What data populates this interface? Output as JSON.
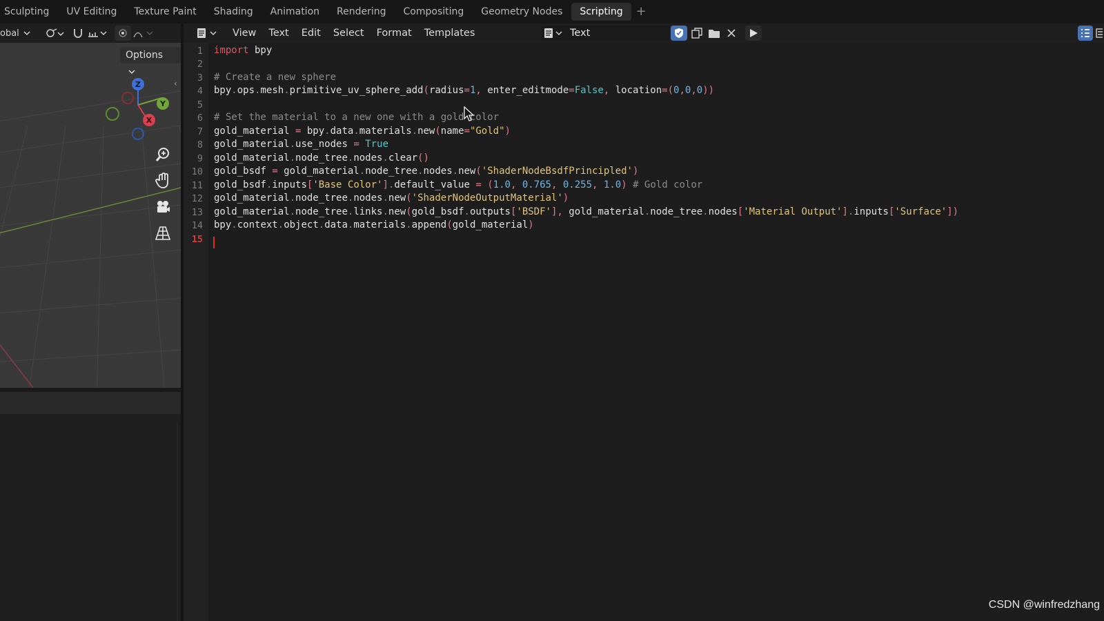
{
  "workspace_tabs": [
    {
      "label": "Sculpting",
      "active": false
    },
    {
      "label": "UV Editing",
      "active": false
    },
    {
      "label": "Texture Paint",
      "active": false
    },
    {
      "label": "Shading",
      "active": false
    },
    {
      "label": "Animation",
      "active": false
    },
    {
      "label": "Rendering",
      "active": false
    },
    {
      "label": "Compositing",
      "active": false
    },
    {
      "label": "Geometry Nodes",
      "active": false
    },
    {
      "label": "Scripting",
      "active": true
    }
  ],
  "add_tab_label": "+",
  "viewport": {
    "orientation_label": "obal",
    "options_label": "Options",
    "gizmo_axes": {
      "z": "Z",
      "y": "Y",
      "x": "X"
    },
    "nav_tools": [
      "zoom-icon",
      "pan-hand-icon",
      "camera-icon",
      "grid-perspective-icon"
    ]
  },
  "text_editor": {
    "menu": [
      "View",
      "Text",
      "Edit",
      "Select",
      "Format",
      "Templates"
    ],
    "datablock_name": "Text",
    "current_line": 15,
    "lines": [
      "import bpy",
      "",
      "# Create a new sphere",
      "bpy.ops.mesh.primitive_uv_sphere_add(radius=1, enter_editmode=False, location=(0,0,0))",
      "",
      "# Set the material to a new one with a gold color",
      "gold_material = bpy.data.materials.new(name=\"Gold\")",
      "gold_material.use_nodes = True",
      "gold_material.node_tree.nodes.clear()",
      "gold_bsdf = gold_material.node_tree.nodes.new('ShaderNodeBsdfPrincipled')",
      "gold_bsdf.inputs['Base Color'].default_value = (1.0, 0.765, 0.255, 1.0) # Gold color",
      "gold_material.node_tree.nodes.new('ShaderNodeOutputMaterial')",
      "gold_material.node_tree.links.new(gold_bsdf.outputs['BSDF'], gold_material.node_tree.nodes['Material Output'].inputs['Surface'])",
      "bpy.context.object.data.materials.append(gold_material)",
      ""
    ]
  },
  "watermark": "CSDN @winfredzhang",
  "colors": {
    "keyword": "#e0555f",
    "comment": "#8b8b8b",
    "string": "#e1c37a",
    "number": "#72b6e4",
    "builtin": "#5ec3c7",
    "current_line_number": "#d83a3a",
    "accent_blue": "#4772b3"
  }
}
